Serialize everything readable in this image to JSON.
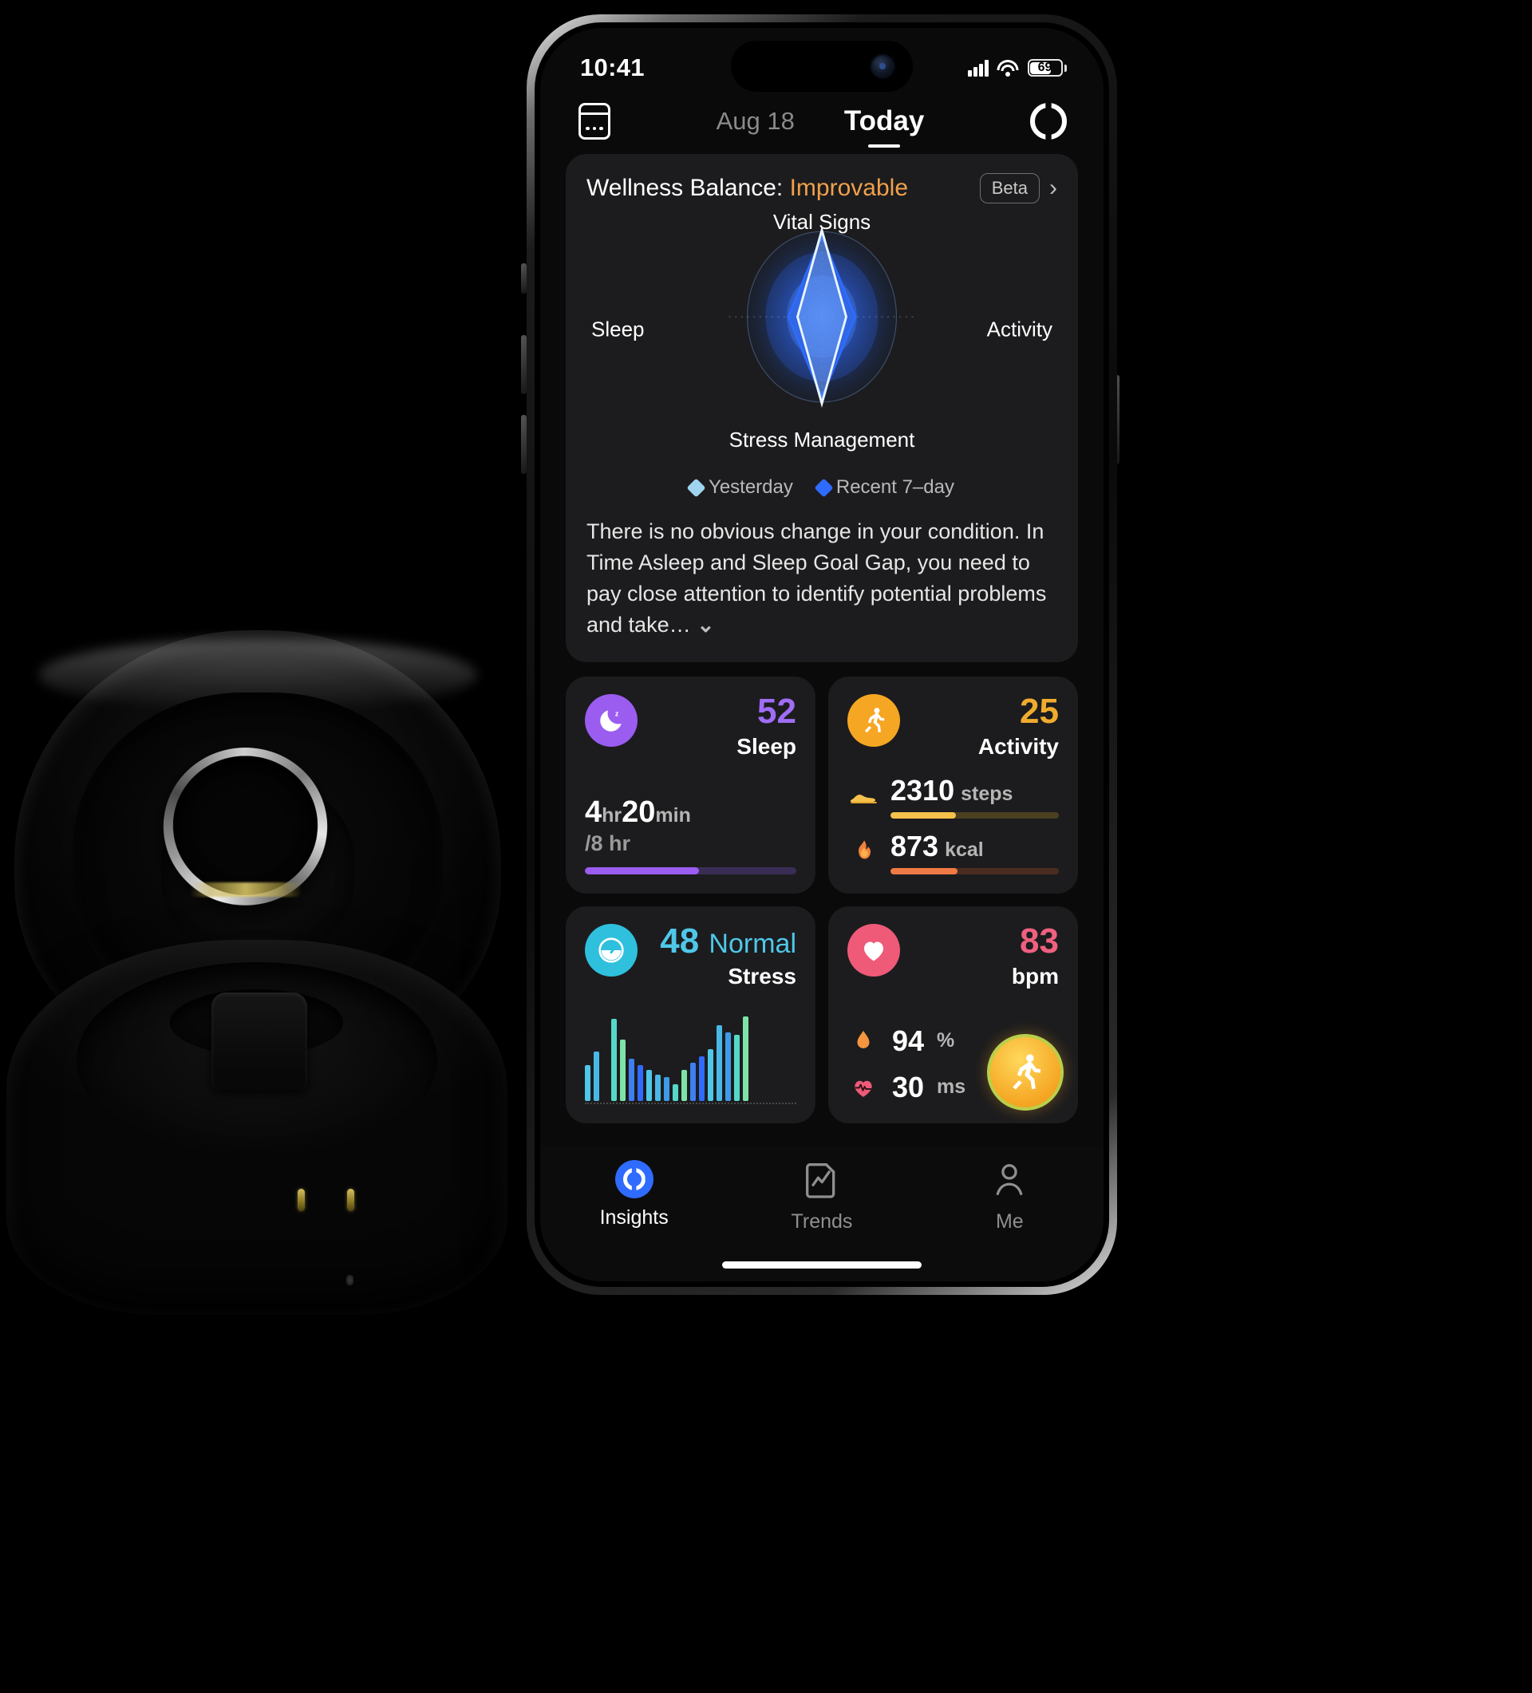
{
  "status_bar": {
    "time": "10:41",
    "battery_level": "69",
    "signal_icon": "cellular-bars-icon",
    "wifi_icon": "wifi-icon",
    "battery_icon": "battery-icon"
  },
  "nav": {
    "calendar_icon": "calendar-icon",
    "prev_date": "Aug 18",
    "current_tab": "Today",
    "sync_icon": "sync-ring-icon"
  },
  "wellness": {
    "title_prefix": "Wellness Balance:",
    "status": "Improvable",
    "status_color": "#f0a04b",
    "beta_label": "Beta",
    "chevron_right": "›",
    "chevron_down": "⌄",
    "axes": {
      "top": "Vital Signs",
      "right": "Activity",
      "bottom": "Stress Management",
      "left": "Sleep"
    },
    "legend": [
      {
        "label": "Yesterday",
        "color": "#9fd4ef"
      },
      {
        "label": "Recent 7–day",
        "color": "#2f6bff"
      }
    ],
    "description": "There is no obvious change in your condition. In Time Asleep and Sleep Goal Gap, you need to pay close attention to identify potential problems and take…"
  },
  "chart_data": {
    "type": "radar",
    "title": "Wellness Balance",
    "categories": [
      "Vital Signs",
      "Activity",
      "Stress Management",
      "Sleep"
    ],
    "series": [
      {
        "name": "Yesterday",
        "color": "#9fd4ef",
        "values": [
          96,
          34,
          96,
          34
        ]
      },
      {
        "name": "Recent 7-day",
        "color": "#2f6bff",
        "values": [
          80,
          44,
          80,
          44
        ]
      }
    ],
    "range": [
      0,
      100
    ],
    "grid": true,
    "legend_position": "bottom"
  },
  "cards": {
    "sleep": {
      "icon": "moon-sleep-icon",
      "icon_color": "#9b5cf0",
      "score": "52",
      "label": "Sleep",
      "duration_hours": "4",
      "duration_hours_unit": "hr",
      "duration_minutes": "20",
      "duration_minutes_unit": "min",
      "goal": "/8 hr",
      "progress_pct": 54,
      "bar_color": "#9b5cf0",
      "bar_track": "#3a2d55"
    },
    "activity": {
      "icon": "running-person-icon",
      "icon_color": "#f5a623",
      "score": "25",
      "label": "Activity",
      "metrics": [
        {
          "icon": "shoe-icon",
          "value": "2310",
          "unit": "steps",
          "progress_pct": 39,
          "color": "#f5c14b",
          "track": "#4a4020"
        },
        {
          "icon": "flame-icon",
          "value": "873",
          "unit": "kcal",
          "progress_pct": 40,
          "color": "#f07a45",
          "track": "#4a2c20"
        }
      ]
    },
    "stress": {
      "icon": "gauge-icon",
      "icon_color": "#2ec0dd",
      "score": "48",
      "status": "Normal",
      "status_color": "#4fc7e8",
      "label": "Stress",
      "bars": [
        30,
        42,
        0,
        70,
        52,
        36,
        30,
        26,
        22,
        20,
        14,
        26,
        32,
        38,
        44,
        64,
        58,
        56,
        72
      ]
    },
    "heart": {
      "icon": "heart-icon",
      "icon_color": "#ee5a78",
      "value": "83",
      "unit": "bpm",
      "metrics": [
        {
          "icon": "blood-drop-icon",
          "value": "94",
          "unit": "%"
        },
        {
          "icon": "heart-pulse-icon",
          "value": "30",
          "unit": "ms"
        }
      ],
      "fab_icon": "workout-run-icon"
    }
  },
  "tabbar": [
    {
      "label": "Insights",
      "icon": "insights-ring-icon",
      "active": true
    },
    {
      "label": "Trends",
      "icon": "trends-chart-icon",
      "active": false
    },
    {
      "label": "Me",
      "icon": "person-icon",
      "active": false
    }
  ]
}
